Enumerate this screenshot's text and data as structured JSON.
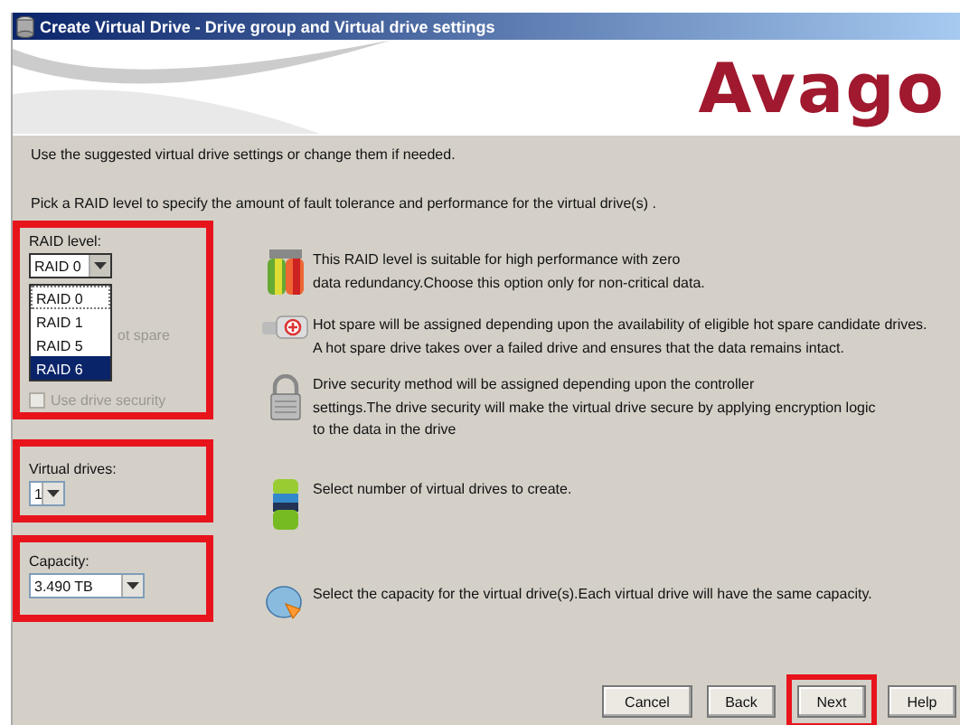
{
  "window": {
    "title": "Create Virtual Drive - Drive group and Virtual drive settings"
  },
  "banner": {
    "logo": "Avago"
  },
  "intro": [
    "Use the suggested virtual drive settings or change them if needed.",
    "Pick a RAID level to specify the amount of fault tolerance and performance for the virtual drive(s) ."
  ],
  "raid_level": {
    "label": "RAID level:",
    "value": "RAID 0",
    "highlighted": true,
    "expanded": true,
    "options": [
      {
        "label": "RAID 0",
        "selected": true,
        "highlighted": false
      },
      {
        "label": "RAID 1",
        "selected": false,
        "highlighted": false
      },
      {
        "label": "RAID 5",
        "selected": false,
        "highlighted": false
      },
      {
        "label": "RAID 6",
        "selected": false,
        "highlighted": true
      }
    ]
  },
  "checkboxes": [
    {
      "kind": "covered",
      "label": "ot spare",
      "disabled": true
    },
    {
      "kind": "checkbox",
      "label": "Use drive security",
      "checked": false,
      "disabled": true
    }
  ],
  "virtual_drives": {
    "label": "Virtual drives:",
    "value": "1",
    "highlighted": true
  },
  "capacity": {
    "label": "Capacity:",
    "value": "3.490 TB",
    "highlighted": true
  },
  "descriptions": [
    {
      "kind": "raid",
      "lines": [
        "This RAID level is suitable for high performance with zero",
        "data redundancy.Choose this option only for non-critical data."
      ]
    },
    {
      "kind": "hotspare",
      "lines": [
        "Hot spare will be assigned depending upon the availability of eligible hot spare candidate drives.",
        "A hot spare drive takes over a failed drive and ensures that the data remains intact."
      ]
    },
    {
      "kind": "lock",
      "lines": [
        "Drive security method will be assigned depending upon the controller",
        "settings.The drive security will make the virtual drive secure by applying encryption logic",
        "to the data in the drive"
      ]
    },
    {
      "kind": "drives",
      "lines": [
        "Select number of virtual drives to create."
      ]
    },
    {
      "kind": "capacity",
      "lines": [
        "Select the capacity for the virtual drive(s).Each virtual drive will have the same capacity."
      ]
    }
  ],
  "buttons": [
    {
      "label": "Cancel",
      "highlighted": false
    },
    {
      "label": "Back",
      "highlighted": false
    },
    {
      "label": "Next",
      "highlighted": true
    },
    {
      "label": "Help",
      "highlighted": false
    }
  ]
}
